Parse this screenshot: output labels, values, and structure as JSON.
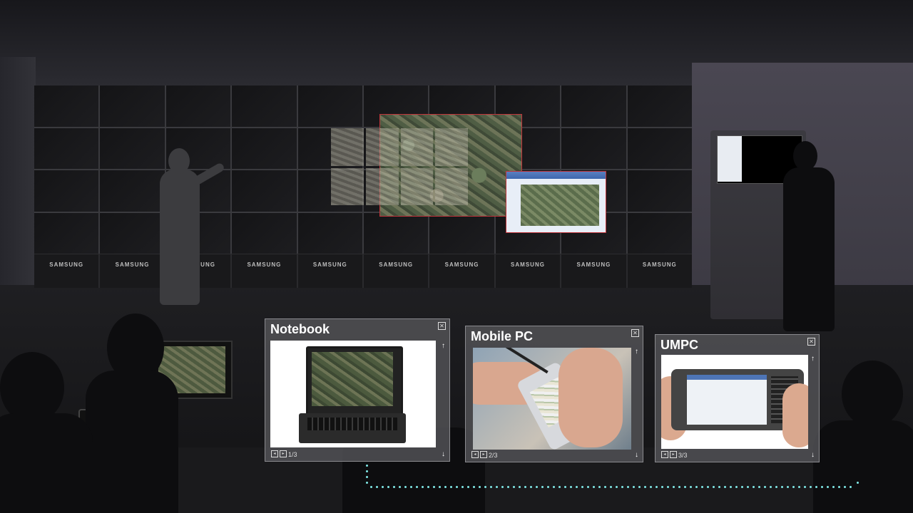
{
  "brand": "SAMSUNG",
  "videowall": {
    "labels": [
      "SAMSUNG",
      "SAMSUNG",
      "SAMSUNG",
      "SAMSUNG",
      "SAMSUNG",
      "SAMSUNG",
      "SAMSUNG",
      "SAMSUNG",
      "SAMSUNG",
      "SAMSUNG"
    ]
  },
  "cards": [
    {
      "title": "Notebook",
      "page": "1/3"
    },
    {
      "title": "Mobile PC",
      "page": "2/3"
    },
    {
      "title": "UMPC",
      "page": "3/3"
    }
  ],
  "colors": {
    "accent_dots": "#7fe8e6",
    "highlight_border": "#c0353b",
    "card_bg": "#505054"
  },
  "icons": {
    "close": "close-icon",
    "up": "arrow-up-icon",
    "down": "arrow-down-icon",
    "prev": "prev-icon",
    "next": "next-icon"
  }
}
